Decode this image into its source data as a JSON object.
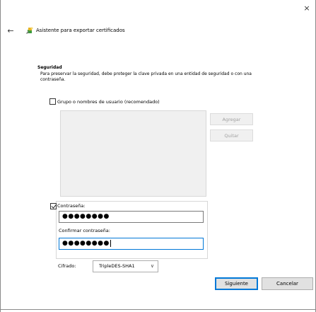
{
  "window": {
    "close_glyph": "×",
    "back_glyph": "←",
    "title": "Asistente para exportar certificados",
    "wizard_icon": "certificate-wizard-icon"
  },
  "security": {
    "heading": "Seguridad",
    "description": "Para preservar la seguridad, debe proteger la clave privada en una entidad de seguridad o con una contraseña.",
    "group_checkbox": {
      "label": "Grupo o nombres de usuario (recomendado)",
      "checked": false
    },
    "group_list": {
      "items": []
    },
    "add_button": "Agregar",
    "remove_button": "Quitar",
    "password_checkbox": {
      "label": "Contraseña:",
      "checked": true
    },
    "password": {
      "value": "●●●●●●●●"
    },
    "confirm_label": "Confirmar contraseña:",
    "confirm": {
      "value": "●●●●●●●●"
    },
    "encryption_label": "Cifrado:",
    "encryption_selected": "TripleDES-SHA1",
    "chevron_glyph": "∨"
  },
  "footer": {
    "next_button": "Siguiente",
    "cancel_button": "Cancelar"
  },
  "colors": {
    "accent": "#0078d7",
    "disabled_text": "#a0a0a0",
    "panel_bg": "#f0f0f0"
  }
}
